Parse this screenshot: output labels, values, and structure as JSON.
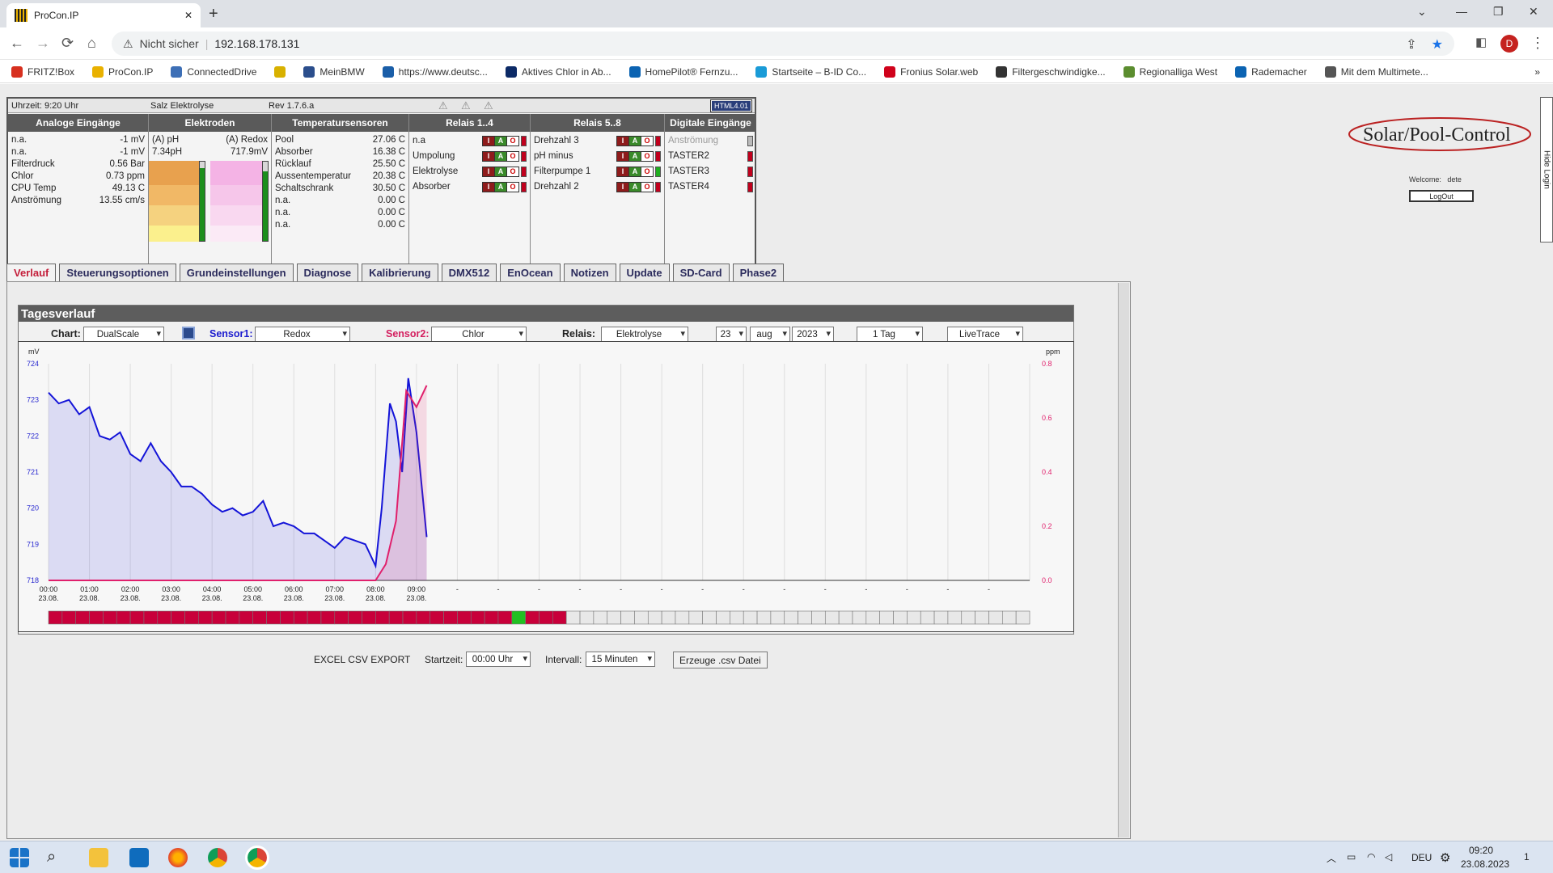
{
  "browser": {
    "tab_title": "ProCon.IP",
    "new_tab": "+",
    "security_text": "Nicht sicher",
    "url": "192.168.178.131",
    "avatar_letter": "D",
    "bookmarks": [
      {
        "label": "FRITZ!Box",
        "color": "#d7301f"
      },
      {
        "label": "ProCon.IP",
        "color": "#e9b100"
      },
      {
        "label": "ConnectedDrive",
        "color": "#3d6fb6"
      },
      {
        "label": "",
        "color": "#d8b100"
      },
      {
        "label": "MeinBMW",
        "color": "#2b4e8c"
      },
      {
        "label": "https://www.deutsc...",
        "color": "#1a5ea8"
      },
      {
        "label": "Aktives Chlor in Ab...",
        "color": "#0c2a66"
      },
      {
        "label": "HomePilot® Fernzu...",
        "color": "#0b63b2"
      },
      {
        "label": "Startseite – B-ID Co...",
        "color": "#1a9bd7"
      },
      {
        "label": "Fronius Solar.web",
        "color": "#d0021b"
      },
      {
        "label": "Filtergeschwindigke...",
        "color": "#333333"
      },
      {
        "label": "Regionalliga West",
        "color": "#5b8d2f"
      },
      {
        "label": "Rademacher",
        "color": "#0b63b2"
      },
      {
        "label": "Mit dem Multimete...",
        "color": "#555555"
      }
    ],
    "bookmarks_more": "»"
  },
  "status": {
    "time": "Uhrzeit: 9:20 Uhr",
    "mode": "Salz Elektrolyse",
    "revision": "Rev 1.7.6.a",
    "badge": "HTML4.01",
    "analog": {
      "header": "Analoge Eingänge",
      "rows": [
        {
          "label": "n.a.",
          "value": "-1 mV"
        },
        {
          "label": "n.a.",
          "value": "-1 mV"
        },
        {
          "label": "Filterdruck",
          "value": "0.56 Bar"
        },
        {
          "label": "Chlor",
          "value": "0.73 ppm"
        },
        {
          "label": "CPU Temp",
          "value": "49.13 C"
        },
        {
          "label": "Anströmung",
          "value": "13.55 cm/s"
        }
      ]
    },
    "electrodes": {
      "header": "Elektroden",
      "ph_label": "(A) pH",
      "ph_value": "7.34pH",
      "redox_label": "(A) Redox",
      "redox_value": "717.9mV",
      "ph_level": 0.92,
      "redox_level": 0.88
    },
    "temps": {
      "header": "Temperatursensoren",
      "rows": [
        {
          "label": "Pool",
          "value": "27.06 C"
        },
        {
          "label": "Absorber",
          "value": "16.38 C"
        },
        {
          "label": "Rücklauf",
          "value": "25.50 C"
        },
        {
          "label": "Aussentemperatur",
          "value": "20.38 C"
        },
        {
          "label": "Schaltschrank",
          "value": "30.50 C"
        },
        {
          "label": "n.a.",
          "value": "0.00 C"
        },
        {
          "label": "n.a.",
          "value": "0.00 C"
        },
        {
          "label": "n.a.",
          "value": "0.00 C"
        }
      ]
    },
    "relays14": {
      "header": "Relais 1..4",
      "rows": [
        {
          "label": "n.a",
          "state": "off"
        },
        {
          "label": "Umpolung",
          "state": "off"
        },
        {
          "label": "Elektrolyse",
          "state": "off"
        },
        {
          "label": "Absorber",
          "state": "off"
        }
      ]
    },
    "relays58": {
      "header": "Relais 5..8",
      "rows": [
        {
          "label": "Drehzahl 3",
          "state": "off"
        },
        {
          "label": "pH minus",
          "state": "off"
        },
        {
          "label": "Filterpumpe 1",
          "state": "on"
        },
        {
          "label": "Drehzahl 2",
          "state": "off"
        }
      ]
    },
    "digital": {
      "header": "Digitale Eingänge",
      "rows": [
        {
          "label": "Anströmung",
          "state": "inactive"
        },
        {
          "label": "TASTER2",
          "state": "off"
        },
        {
          "label": "TASTER3",
          "state": "off"
        },
        {
          "label": "TASTER4",
          "state": "off"
        }
      ]
    },
    "iao": {
      "i": "I",
      "a": "A",
      "o": "O"
    }
  },
  "logo": {
    "text": "Solar/Pool-Control"
  },
  "login": {
    "welcome": "Welcome:",
    "user": "dete",
    "logout": "LogOut",
    "hide": "Hide Login"
  },
  "tabs": [
    "Verlauf",
    "Steuerungsoptionen",
    "Grundeinstellungen",
    "Diagnose",
    "Kalibrierung",
    "DMX512",
    "EnOcean",
    "Notizen",
    "Update",
    "SD-Card",
    "Phase2"
  ],
  "panel": {
    "title": "Tagesverlauf",
    "chart_label": "Chart:",
    "chart_value": "DualScale",
    "sensor1_label": "Sensor1:",
    "sensor1_value": "Redox",
    "sensor2_label": "Sensor2:",
    "sensor2_value": "Chlor",
    "relais_label": "Relais:",
    "relais_value": "Elektrolyse",
    "day": "23",
    "month": "aug",
    "year": "2023",
    "range": "1 Tag",
    "mode": "LiveTrace"
  },
  "chart_data": {
    "type": "line",
    "left_unit": "mV",
    "right_unit": "ppm",
    "y_left": {
      "min": 718,
      "max": 724,
      "ticks": [
        718,
        719,
        720,
        721,
        722,
        723,
        724
      ]
    },
    "y_right": {
      "min": 0.0,
      "max": 0.8,
      "ticks": [
        "0.0",
        "0.2",
        "0.4",
        "0.6",
        "0.8"
      ]
    },
    "x_labels": [
      [
        "00:00",
        "23.08."
      ],
      [
        "01:00",
        "23.08."
      ],
      [
        "02:00",
        "23.08."
      ],
      [
        "03:00",
        "23.08."
      ],
      [
        "04:00",
        "23.08."
      ],
      [
        "05:00",
        "23.08."
      ],
      [
        "06:00",
        "23.08."
      ],
      [
        "07:00",
        "23.08."
      ],
      [
        "08:00",
        "23.08."
      ],
      [
        "09:00",
        "23.08."
      ],
      [
        "-",
        ""
      ],
      [
        "-",
        ""
      ],
      [
        "-",
        ""
      ],
      [
        "-",
        ""
      ],
      [
        "-",
        ""
      ],
      [
        "-",
        ""
      ],
      [
        "-",
        ""
      ],
      [
        "-",
        ""
      ],
      [
        "-",
        ""
      ],
      [
        "-",
        ""
      ],
      [
        "-",
        ""
      ],
      [
        "-",
        ""
      ],
      [
        "-",
        ""
      ],
      [
        "-",
        ""
      ]
    ],
    "series": [
      {
        "color": "#1414d8",
        "axis": "left",
        "x": [
          0,
          0.25,
          0.5,
          0.75,
          1.0,
          1.25,
          1.5,
          1.75,
          2.0,
          2.25,
          2.5,
          2.75,
          3.0,
          3.25,
          3.5,
          3.75,
          4.0,
          4.25,
          4.5,
          4.75,
          5.0,
          5.25,
          5.5,
          5.75,
          6.0,
          6.25,
          6.5,
          6.75,
          7.0,
          7.25,
          7.5,
          7.75,
          8.0,
          8.15,
          8.35,
          8.5,
          8.65,
          8.8,
          9.0,
          9.25
        ],
        "y": [
          723.2,
          722.9,
          723.0,
          722.6,
          722.8,
          722.0,
          721.9,
          722.1,
          721.5,
          721.3,
          721.8,
          721.3,
          721.0,
          720.6,
          720.6,
          720.4,
          720.1,
          719.9,
          720.0,
          719.8,
          719.9,
          720.2,
          719.5,
          719.6,
          719.5,
          719.3,
          719.3,
          719.1,
          718.9,
          719.2,
          719.1,
          719.0,
          718.4,
          720.0,
          722.9,
          722.4,
          721.0,
          723.6,
          722.1,
          719.2
        ]
      },
      {
        "color": "#e0206c",
        "axis": "right",
        "x": [
          0,
          8.0,
          8.25,
          8.5,
          8.75,
          9.0,
          9.25
        ],
        "y": [
          0.0,
          0.0,
          0.06,
          0.22,
          0.7,
          0.64,
          0.72
        ]
      }
    ],
    "relay_bar": {
      "total": 72,
      "on": [
        0,
        1,
        2,
        3,
        4,
        5,
        6,
        7,
        8,
        9,
        10,
        11,
        12,
        13,
        14,
        15,
        16,
        17,
        18,
        19,
        20,
        21,
        22,
        23,
        24,
        25,
        26,
        27,
        28,
        29,
        30,
        31,
        32,
        33,
        35,
        36,
        37
      ],
      "active": [
        34
      ]
    }
  },
  "export": {
    "title": "EXCEL CSV EXPORT",
    "start_label": "Startzeit:",
    "start_value": "00:00 Uhr",
    "interval_label": "Intervall:",
    "interval_value": "15 Minuten",
    "button": "Erzeuge .csv Datei"
  },
  "taskbar": {
    "lang": "DEU",
    "time": "09:20",
    "date": "23.08.2023",
    "notif": "1"
  }
}
